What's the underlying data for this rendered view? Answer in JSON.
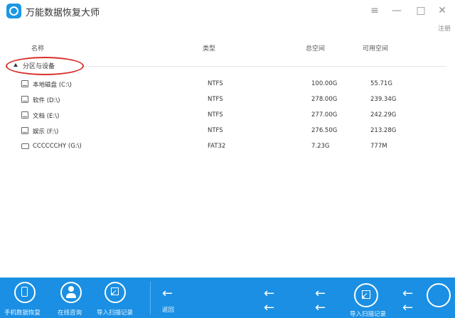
{
  "window": {
    "title": "万能数据恢复大师",
    "menu_icon": "menu-icon",
    "minimize": "—",
    "maximize": "□",
    "close": "✕",
    "register": "注册"
  },
  "table": {
    "headers": {
      "name": "名称",
      "type": "类型",
      "total": "总空间",
      "free": "可用空间"
    },
    "group_label": "分区与设备",
    "rows": [
      {
        "icon": "hard-disk-icon",
        "name": "本地磁盘 (C:\\)",
        "type": "NTFS",
        "total": "100.00G",
        "free": "55.71G"
      },
      {
        "icon": "drive-icon",
        "name": "软件 (D:\\)",
        "type": "NTFS",
        "total": "278.00G",
        "free": "239.34G"
      },
      {
        "icon": "drive-icon",
        "name": "文档 (E:\\)",
        "type": "NTFS",
        "total": "277.00G",
        "free": "242.29G"
      },
      {
        "icon": "drive-icon",
        "name": "娱乐 (F:\\)",
        "type": "NTFS",
        "total": "276.50G",
        "free": "213.28G"
      },
      {
        "icon": "usb-drive-icon",
        "name": "CCCCCCHY (G:\\)",
        "type": "FAT32",
        "total": "7.23G",
        "free": "777M"
      }
    ]
  },
  "bottom_bar": {
    "phone_recovery": "手机数据恢复",
    "online_consult": "在线咨询",
    "import_scan": "导入扫描记录",
    "back": "返回",
    "import_scan_2": "导入扫描记录",
    "back_arrow": "←",
    "colors": {
      "bar": "#1a8fe3"
    }
  }
}
